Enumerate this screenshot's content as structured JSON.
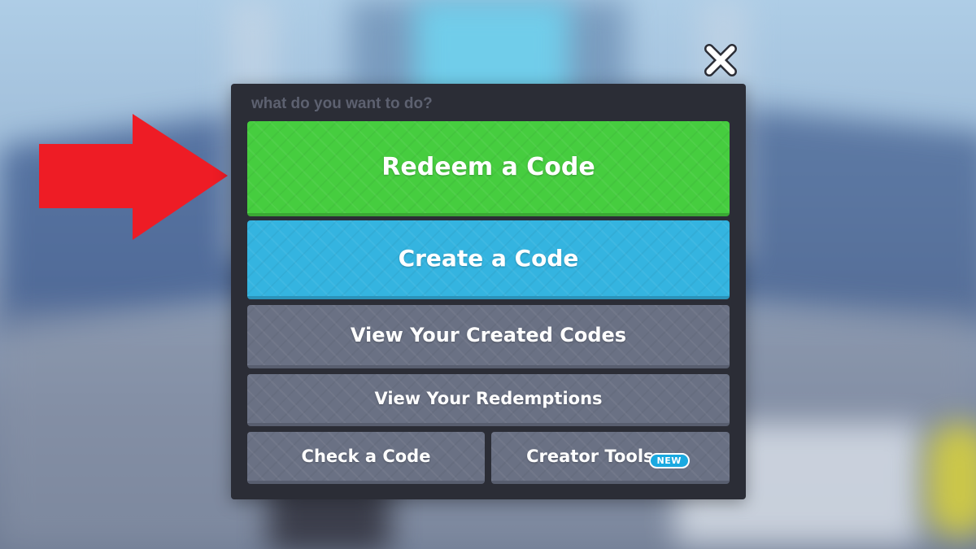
{
  "dialog": {
    "prompt": "what do you want to do?",
    "buttons": {
      "redeem": "Redeem a Code",
      "create": "Create a Code",
      "view_created": "View Your Created Codes",
      "view_redemptions": "View Your Redemptions",
      "check": "Check a Code",
      "creator_tools": "Creator Tools"
    },
    "creator_badge": "NEW"
  },
  "icons": {
    "close": "close-icon",
    "pointer": "red-arrow-icon"
  },
  "colors": {
    "panel": "#2b2d36",
    "redeem": "#46cd3f",
    "create": "#34b4e0",
    "secondary": "#6a7184",
    "arrow": "#ee1c25",
    "badge": "#1aa9e0"
  }
}
